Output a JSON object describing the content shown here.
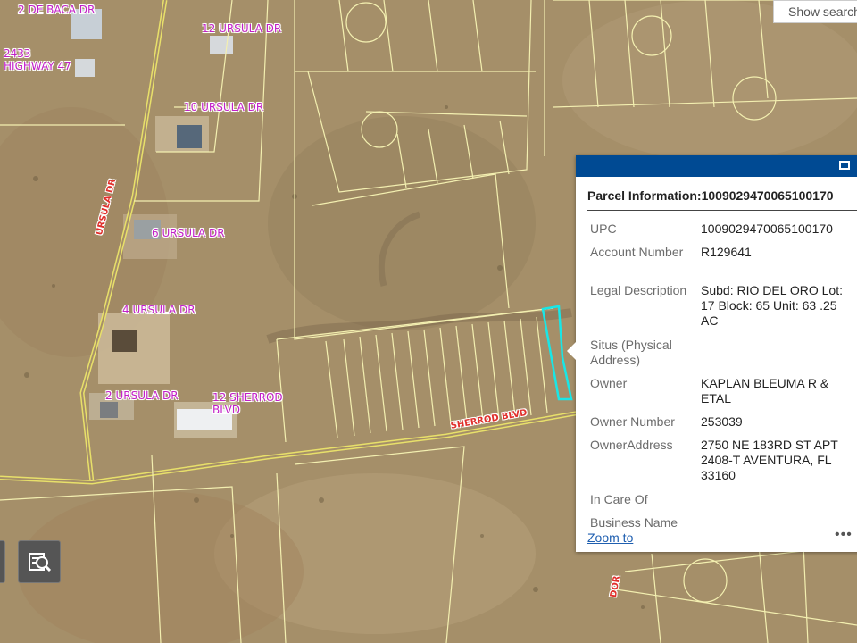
{
  "map": {
    "addresses": [
      "2 DE BACA DR",
      "2433 HIGHWAY 47",
      "12 URSULA DR",
      "10 URSULA DR",
      "6 URSULA DR",
      "4 URSULA DR",
      "2 URSULA DR",
      "12 SHERROD BLVD"
    ],
    "roads": {
      "ursula": "URSULA DR",
      "sherrod": "SHERROD BLVD",
      "south": "DOR"
    }
  },
  "search": {
    "placeholder": "Show search"
  },
  "popup": {
    "title": "Parcel Information:1009029470065100170",
    "fields": [
      {
        "label": "UPC",
        "value": "1009029470065100170"
      },
      {
        "label": "Account Number",
        "value": "R129641"
      },
      {
        "label": "Legal Description",
        "value": "Subd: RIO DEL ORO Lot: 17 Block: 65 Unit: 63 .25 AC"
      },
      {
        "label": "Situs (Physical Address)",
        "value": ""
      },
      {
        "label": "Owner",
        "value": "KAPLAN BLEUMA R & ETAL"
      },
      {
        "label": "Owner Number",
        "value": "253039"
      },
      {
        "label": "OwnerAddress",
        "value": "2750 NE 183RD ST APT 2408-T AVENTURA, FL 33160"
      },
      {
        "label": "In Care Of",
        "value": ""
      },
      {
        "label": "Business Name",
        "value": ""
      }
    ],
    "zoom_label": "Zoom to",
    "more_label": "•••"
  },
  "colors": {
    "header": "#004a93",
    "address_label": "#c21fc7",
    "parcel_lines": "#f3efb0",
    "selected_parcel": "#19e6e6"
  }
}
